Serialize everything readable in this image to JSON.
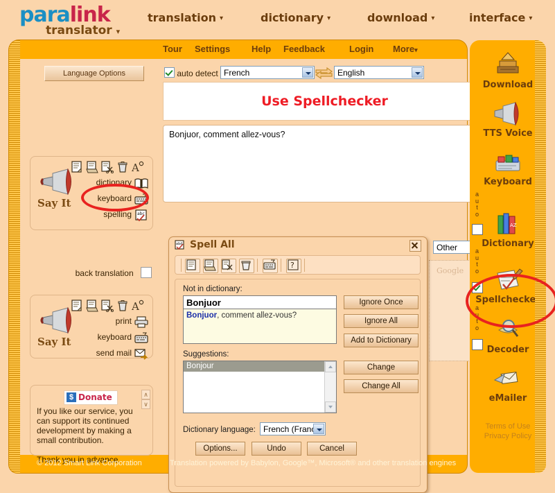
{
  "brand": {
    "part1": "para",
    "part2": "link",
    "sub": "translator",
    "caret": "▾"
  },
  "topnav": [
    {
      "label": "translation",
      "caret": "▾"
    },
    {
      "label": "dictionary",
      "caret": "▾"
    },
    {
      "label": "download",
      "caret": "▾"
    },
    {
      "label": "interface",
      "caret": "▾"
    }
  ],
  "menubar": [
    {
      "label": "Tour"
    },
    {
      "label": "Settings"
    },
    {
      "label": "Help"
    },
    {
      "label": "Feedback"
    },
    {
      "label": "Login"
    },
    {
      "label": "More",
      "caret": "▾"
    }
  ],
  "toolbar": {
    "language_options": "Language Options",
    "auto_detect": "auto detect",
    "auto_detect_checked": true,
    "source_language": "French",
    "target_language": "English",
    "swap_icon": "swap-languages-icon"
  },
  "main": {
    "title": "Use Spellchecker",
    "source_text": "Bonjuor, comment allez-vous?",
    "engine": "Other",
    "google_logo": "Google"
  },
  "left_panel_top": {
    "say_it": "Say It",
    "icons": [
      "new-document-icon",
      "open-document-icon",
      "cut-document-icon",
      "delete-icon",
      "font-size-icon"
    ],
    "rows": [
      {
        "label": "dictionary",
        "icon": "book-icon"
      },
      {
        "label": "keyboard",
        "icon": "keyboard-icon"
      },
      {
        "label": "spelling",
        "icon": "spellcheck-abc-icon"
      }
    ],
    "back_translation": "back translation",
    "back_translation_checked": false
  },
  "left_panel_bottom": {
    "say_it": "Say It",
    "icons": [
      "new-document-icon",
      "open-document-icon",
      "cut-document-icon",
      "delete-icon",
      "font-size-icon"
    ],
    "rows": [
      {
        "label": "print",
        "icon": "printer-icon"
      },
      {
        "label": "keyboard",
        "icon": "keyboard-icon"
      },
      {
        "label": "send mail",
        "icon": "send-mail-icon"
      }
    ]
  },
  "donate": {
    "badge": "Donate",
    "dollar": "$",
    "body": "If you like our service, you can support its continued development by making a small contribution.",
    "thanks": "Thank you in advance.",
    "scroll_up": "∧",
    "scroll_down": "∨"
  },
  "dialog": {
    "title": "Spell All",
    "icon": "spellcheck-abc-icon",
    "close": "close-icon",
    "toolbar_icons": [
      "new-document-icon",
      "open-document-icon",
      "cut-document-icon",
      "delete-icon",
      "keyboard-icon",
      "help-icon"
    ],
    "not_in_dictionary_label": "Not in dictionary:",
    "not_in_dictionary_word": "Bonjuor",
    "context_bold": "Bonjuor",
    "context_rest": ", comment allez-vous?",
    "buttons": {
      "ignore_once": "Ignore Once",
      "ignore_all": "Ignore All",
      "add_to_dictionary": "Add to Dictionary",
      "change": "Change",
      "change_all": "Change All",
      "options": "Options...",
      "undo": "Undo",
      "cancel": "Cancel"
    },
    "suggestions_label": "Suggestions:",
    "suggestions": [
      "Bonjour"
    ],
    "dictionary_language_label": "Dictionary language:",
    "dictionary_language": "French (France"
  },
  "rail": {
    "tools": [
      {
        "label": "Download",
        "icon": "download-books-icon"
      },
      {
        "label": "TTS Voice",
        "icon": "megaphone-icon"
      },
      {
        "label": "Keyboard",
        "icon": "keyboard-color-icon"
      },
      {
        "label": "Dictionary",
        "icon": "dictionary-books-icon"
      },
      {
        "label": "Spellchecker",
        "icon": "spellchecker-pen-icon"
      },
      {
        "label": "Decoder",
        "icon": "decoder-magnifier-icon"
      },
      {
        "label": "eMailer",
        "icon": "emailer-plane-icon"
      }
    ],
    "auto_labels": [
      {
        "text": "auto",
        "checked": false
      },
      {
        "text": "auto",
        "checked": true
      },
      {
        "text": "auto",
        "checked": false
      }
    ],
    "terms": "Terms of Use",
    "privacy": "Privacy Policy"
  },
  "footer": {
    "copyright": "© 2012 Smart Link Corporation",
    "powered": "Translation powered by Babylon, Google™, Microsoft® and other translation engines"
  },
  "colors": {
    "accent": "#ffad00",
    "page": "#fbd5ab",
    "title": "#ee1c25",
    "highlight": "#e8221f"
  }
}
